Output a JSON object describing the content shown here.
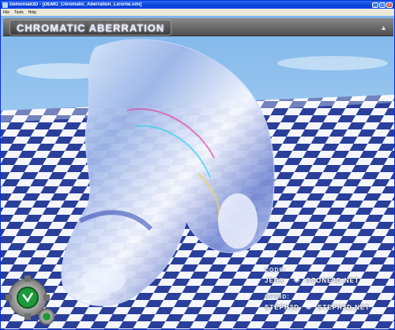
{
  "window": {
    "title": "Demoniak3D - [DEMO_Chromatic_Aberration_Licorne.xml]",
    "buttons": {
      "minimize": "_",
      "maximize": "□",
      "close": "×"
    }
  },
  "menu": [
    "File",
    "Tools",
    "Help"
  ],
  "banner": {
    "title": "CHROMATIC ABERRATION",
    "collapse_glyph": "▲"
  },
  "credits": {
    "code_label": "CODE:",
    "code_author": "JEGX",
    "code_site": "OZONE3D.NET",
    "gfx_label": "GFX3D:",
    "gfx_author": "STEPH3D",
    "gfx_site": "STEPH3D.NET"
  },
  "icons": {
    "app": "demoniak3d-icon",
    "logo": "gears-logo-icon",
    "credit_mark": "star-swirl-icon"
  }
}
